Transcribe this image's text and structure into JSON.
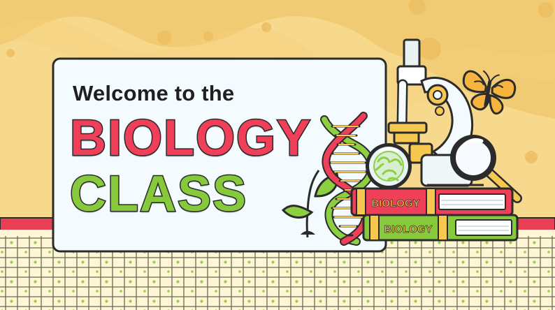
{
  "title_card": {
    "welcome_text": "Welcome to the",
    "title_line_1": "BIOLOGY",
    "title_line_2": "CLASS"
  },
  "books": {
    "top_book_label": "BIOLOGY",
    "bottom_book_label": "BIOLOGY"
  },
  "colors": {
    "background": "#f7d98d",
    "background_blob": "#f0c86f",
    "card": "#f3fbff",
    "card_border": "#2b2b2b",
    "red_stripe": "#e73f54",
    "floor": "#fff6d5",
    "floor_lines": "#5f6a4b",
    "floor_dots": "#9ad045",
    "accent_red": "#ef3f59",
    "accent_green": "#86c93b"
  },
  "icons": [
    "dna-icon",
    "sprout-icon",
    "microscope-icon",
    "magnifying-glass-icon",
    "butterfly-icon",
    "petri-dish-icon",
    "book-icon"
  ]
}
